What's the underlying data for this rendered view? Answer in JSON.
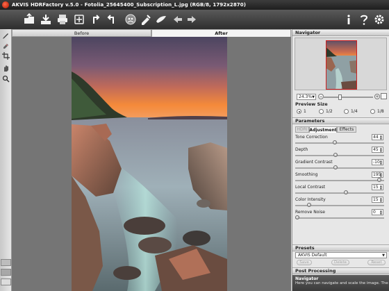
{
  "window": {
    "title": "AKVIS HDRFactory v.5.0 - Fotolia_25645400_Subscription_L.jpg (RGB/8, 1792x2870)"
  },
  "toolbar": {
    "buttons": [
      "open-icon",
      "save-icon",
      "print-icon",
      "batch-icon",
      "undo-icon",
      "redo-icon",
      "plugin-icon",
      "settings-share-icon",
      "share-icon",
      "back-icon",
      "forward-icon",
      "info-icon",
      "help-icon",
      "gear-icon"
    ]
  },
  "view_tabs": {
    "before": "Before",
    "after": "After"
  },
  "navigator": {
    "header": "Navigator",
    "zoom": "24.3%",
    "zoom_level": 0.33
  },
  "preview_size": {
    "label": "Preview Size",
    "options": [
      "1",
      "1/2",
      "1/4",
      "1/8"
    ],
    "selected": "1"
  },
  "parameters": {
    "header": "Parameters",
    "tabs": [
      "HDRI",
      "Adjustment",
      "Effects"
    ],
    "active_tab": "Adjustment",
    "items": [
      {
        "label": "Tone Correction",
        "value": "44",
        "level": 0.44
      },
      {
        "label": "Depth",
        "value": "45",
        "level": 0.45
      },
      {
        "label": "Gradient Contrast",
        "value": "-10",
        "level": 0.45
      },
      {
        "label": "Smoothing",
        "value": "195",
        "level": 0.97
      },
      {
        "label": "Local Contrast",
        "value": "15",
        "level": 0.57
      },
      {
        "label": "Color Intensity",
        "value": "15",
        "level": 0.14
      },
      {
        "label": "Remove Noise",
        "value": "0",
        "level": 0.0
      }
    ]
  },
  "presets": {
    "header": "Presets",
    "selected": "AKVIS Default",
    "save": "Save",
    "delete": "Delete",
    "reset": "Reset"
  },
  "post_processing": {
    "header": "Post Processing"
  },
  "help": {
    "title": "Navigator",
    "text": "Here you can navigate and scale the image. The"
  }
}
